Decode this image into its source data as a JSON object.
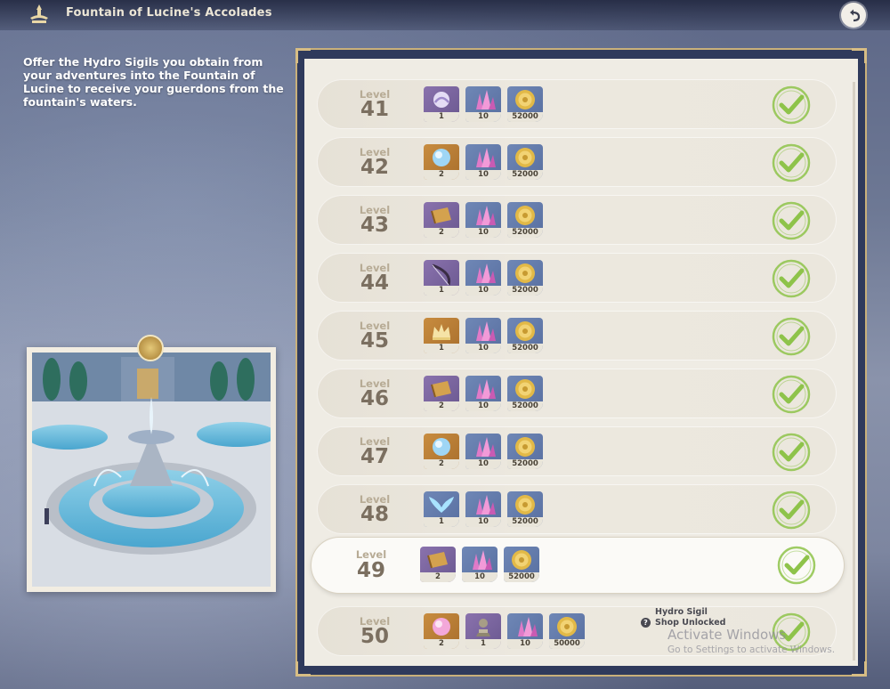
{
  "header": {
    "title": "Fountain of Lucine's Accolades",
    "icon": "fountain-emblem-icon",
    "back_icon": "back-arrow-icon"
  },
  "description": "Offer the Hydro Sigils you obtain from your adventures into the Fountain of Lucine to receive your guerdons from the fountain's waters.",
  "colors": {
    "check": "#8ec34a",
    "panel_border": "#c9b07a",
    "rarity_purple": "#8a72ad",
    "rarity_blue": "#6f87b6",
    "rarity_gold": "#c88c3f"
  },
  "levels": [
    {
      "label": "Level",
      "number": "41",
      "claimed": true,
      "rewards": [
        {
          "icon": "weapon-catalyst-icon",
          "rarity": "purple",
          "qty": "1"
        },
        {
          "icon": "crystal-icon",
          "rarity": "blue",
          "qty": "10"
        },
        {
          "icon": "mora-coin-icon",
          "rarity": "blue",
          "qty": "52000"
        }
      ]
    },
    {
      "label": "Level",
      "number": "42",
      "claimed": true,
      "rewards": [
        {
          "icon": "hydro-orb-icon",
          "rarity": "gold",
          "qty": "2"
        },
        {
          "icon": "crystal-icon",
          "rarity": "blue",
          "qty": "10"
        },
        {
          "icon": "mora-coin-icon",
          "rarity": "blue",
          "qty": "52000"
        }
      ]
    },
    {
      "label": "Level",
      "number": "43",
      "claimed": true,
      "rewards": [
        {
          "icon": "scroll-icon",
          "rarity": "purple",
          "qty": "2"
        },
        {
          "icon": "crystal-icon",
          "rarity": "blue",
          "qty": "10"
        },
        {
          "icon": "mora-coin-icon",
          "rarity": "blue",
          "qty": "52000"
        }
      ]
    },
    {
      "label": "Level",
      "number": "44",
      "claimed": true,
      "rewards": [
        {
          "icon": "weapon-bow-icon",
          "rarity": "purple",
          "qty": "1"
        },
        {
          "icon": "crystal-icon",
          "rarity": "blue",
          "qty": "10"
        },
        {
          "icon": "mora-coin-icon",
          "rarity": "blue",
          "qty": "52000"
        }
      ]
    },
    {
      "label": "Level",
      "number": "45",
      "claimed": true,
      "rewards": [
        {
          "icon": "crown-icon",
          "rarity": "gold",
          "qty": "1"
        },
        {
          "icon": "crystal-icon",
          "rarity": "blue",
          "qty": "10"
        },
        {
          "icon": "mora-coin-icon",
          "rarity": "blue",
          "qty": "52000"
        }
      ]
    },
    {
      "label": "Level",
      "number": "46",
      "claimed": true,
      "rewards": [
        {
          "icon": "scroll-icon",
          "rarity": "purple",
          "qty": "2"
        },
        {
          "icon": "crystal-icon",
          "rarity": "blue",
          "qty": "10"
        },
        {
          "icon": "mora-coin-icon",
          "rarity": "blue",
          "qty": "52000"
        }
      ]
    },
    {
      "label": "Level",
      "number": "47",
      "claimed": true,
      "rewards": [
        {
          "icon": "hydro-orb-icon",
          "rarity": "gold",
          "qty": "2"
        },
        {
          "icon": "crystal-icon",
          "rarity": "blue",
          "qty": "10"
        },
        {
          "icon": "mora-coin-icon",
          "rarity": "blue",
          "qty": "52000"
        }
      ]
    },
    {
      "label": "Level",
      "number": "48",
      "claimed": true,
      "rewards": [
        {
          "icon": "wings-icon",
          "rarity": "blue",
          "qty": "1"
        },
        {
          "icon": "crystal-icon",
          "rarity": "blue",
          "qty": "10"
        },
        {
          "icon": "mora-coin-icon",
          "rarity": "blue",
          "qty": "52000"
        }
      ]
    },
    {
      "label": "Level",
      "number": "49",
      "claimed": true,
      "selected": true,
      "rewards": [
        {
          "icon": "scroll-icon",
          "rarity": "purple",
          "qty": "2"
        },
        {
          "icon": "crystal-icon",
          "rarity": "blue",
          "qty": "10"
        },
        {
          "icon": "mora-coin-icon",
          "rarity": "blue",
          "qty": "52000"
        }
      ]
    },
    {
      "label": "Level",
      "number": "50",
      "claimed": true,
      "rewards": [
        {
          "icon": "pink-orb-icon",
          "rarity": "gold",
          "qty": "2"
        },
        {
          "icon": "statue-icon",
          "rarity": "purple",
          "qty": "1"
        },
        {
          "icon": "crystal-icon",
          "rarity": "blue",
          "qty": "10"
        },
        {
          "icon": "mora-coin-icon",
          "rarity": "blue",
          "qty": "50000"
        }
      ]
    }
  ],
  "shop_note": {
    "line1": "Hydro Sigil",
    "line2": "Shop Unlocked"
  },
  "watermark": {
    "title": "Activate Windows",
    "subtitle": "Go to Settings to activate Windows."
  }
}
